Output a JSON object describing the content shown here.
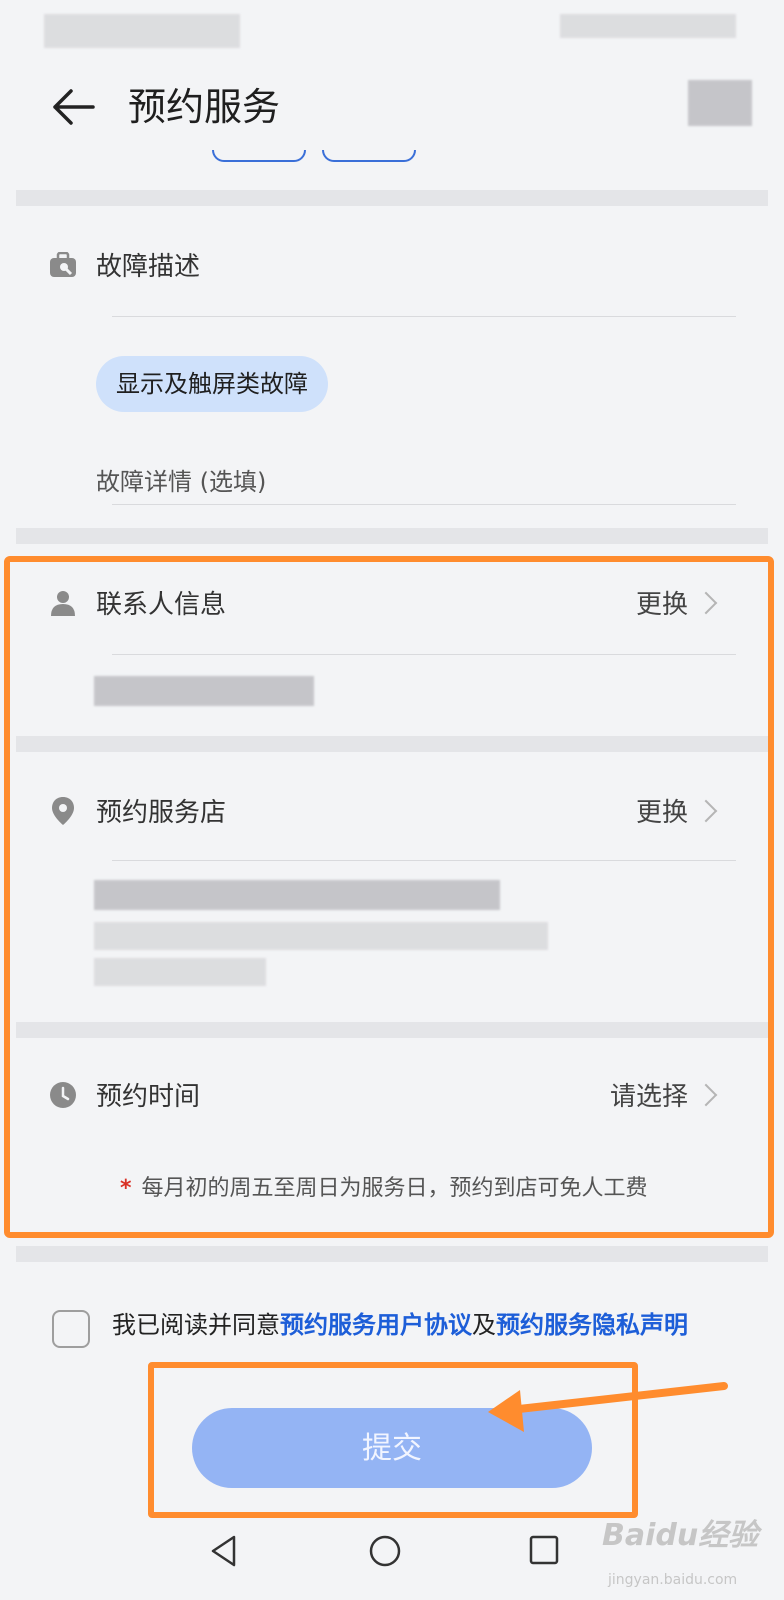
{
  "header": {
    "title": "预约服务"
  },
  "fault": {
    "label": "故障描述",
    "chip": "显示及触屏类故障",
    "detail_placeholder": "故障详情 (选填)"
  },
  "contact": {
    "label": "联系人信息",
    "action": "更换"
  },
  "store": {
    "label": "预约服务店",
    "action": "更换"
  },
  "time": {
    "label": "预约时间",
    "action": "请选择",
    "note_star": "*",
    "note": "每月初的周五至周日为服务日，预约到店可免人工费"
  },
  "agreement": {
    "prefix": "我已阅读并同意",
    "link1": "预约服务用户协议",
    "middle": "及",
    "link2": "预约服务隐私声明"
  },
  "submit": {
    "label": "提交"
  },
  "watermark": {
    "text": "Baidu经验",
    "sub": "jingyan.baidu.com"
  },
  "colors": {
    "accent": "#1d5ed8",
    "highlight": "#ff8c2e",
    "submit": "#94b4f4"
  }
}
